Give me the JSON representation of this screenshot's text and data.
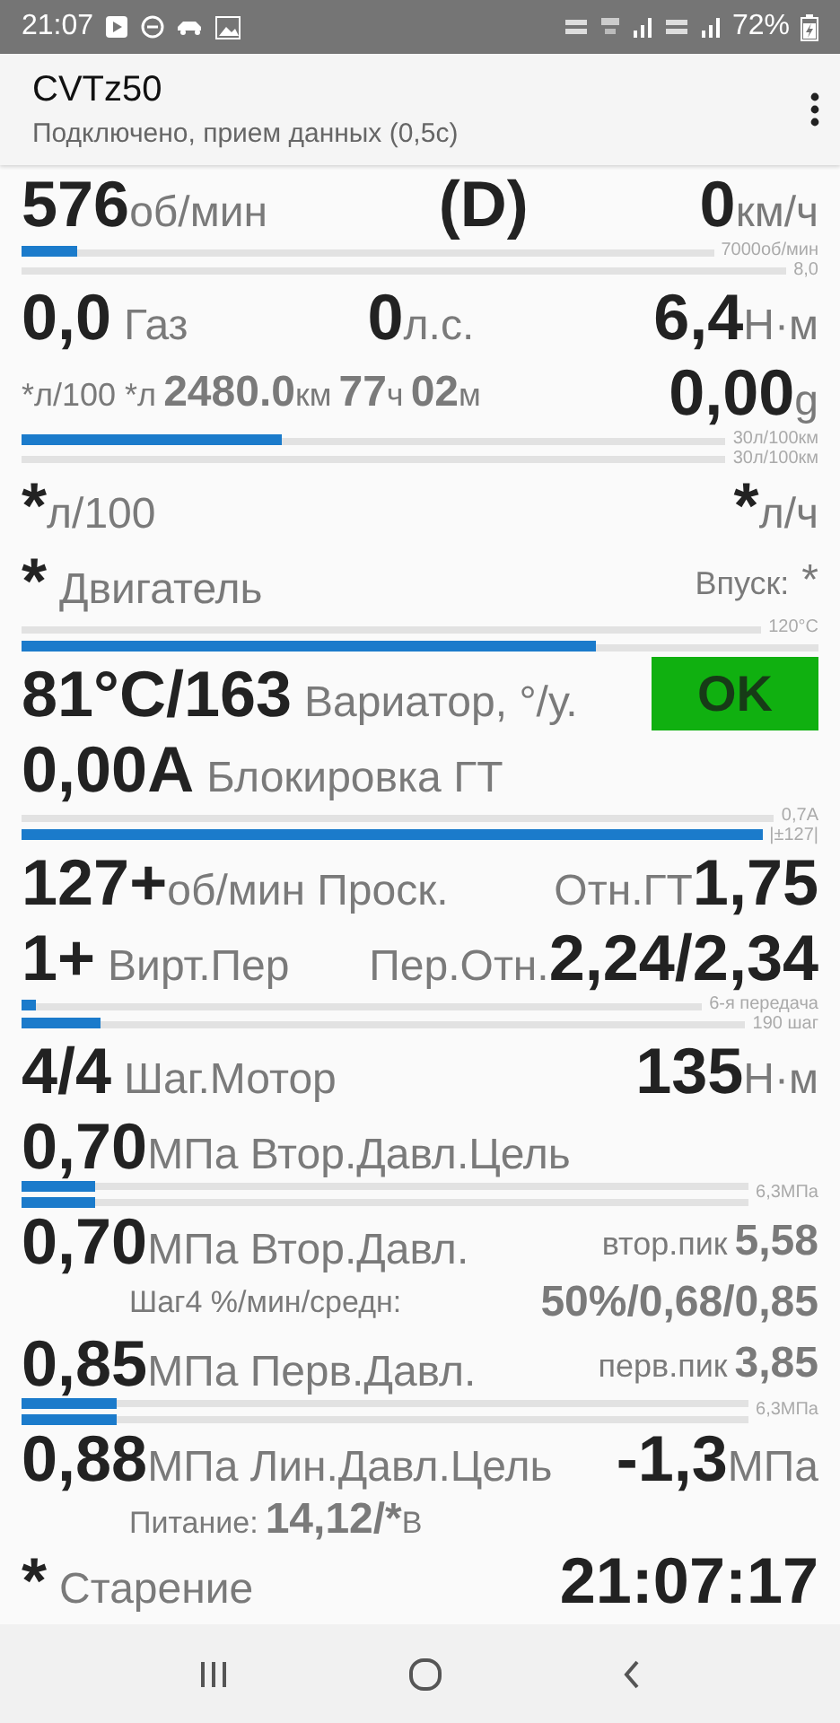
{
  "status_bar": {
    "time": "21:07",
    "battery": "72%"
  },
  "app_bar": {
    "title": "CVTz50",
    "subtitle": "Подключено, прием данных (0,5с)"
  },
  "rows": [
    {
      "kind": "line",
      "segments": [
        [
          {
            "kind": "big",
            "text": "576"
          },
          {
            "kind": "unit",
            "text": "об/мин"
          }
        ],
        [
          {
            "kind": "big",
            "text": "(D)"
          }
        ],
        [
          {
            "kind": "big",
            "text": "0"
          },
          {
            "kind": "unit",
            "text": "км/ч"
          }
        ]
      ]
    },
    {
      "kind": "bar",
      "level": 0.08,
      "caption": "7000об/мин"
    },
    {
      "kind": "bar",
      "level": 0,
      "caption": "8,0"
    },
    {
      "kind": "line",
      "segments": [
        [
          {
            "kind": "big",
            "text": "0,0"
          },
          {
            "kind": "label",
            "text": "Газ"
          }
        ],
        [
          {
            "kind": "big",
            "text": "0"
          },
          {
            "kind": "unit",
            "text": "л.с."
          }
        ],
        [
          {
            "kind": "big",
            "text": "6,4"
          },
          {
            "kind": "unit",
            "text": "Н·м"
          }
        ]
      ]
    },
    {
      "kind": "line",
      "segments": [
        [
          {
            "kind": "small",
            "text": "*л/100 *л"
          },
          {
            "kind": "mid",
            "text": "2480.0"
          },
          {
            "kind": "small",
            "text": "км"
          },
          {
            "kind": "mid",
            "text": "77"
          },
          {
            "kind": "small",
            "text": "ч"
          },
          {
            "kind": "mid",
            "text": "02"
          },
          {
            "kind": "small",
            "text": "м"
          }
        ],
        [
          {
            "kind": "big",
            "text": "0,00"
          },
          {
            "kind": "unit",
            "text": "g"
          }
        ]
      ]
    },
    {
      "kind": "bar",
      "level": 0.37,
      "caption": "30л/100км"
    },
    {
      "kind": "bar",
      "level": 0,
      "caption": "30л/100км"
    },
    {
      "kind": "line",
      "segments": [
        [
          {
            "kind": "big",
            "text": "*"
          },
          {
            "kind": "unit",
            "text": "л/100"
          }
        ],
        [
          {
            "kind": "big",
            "text": "*"
          },
          {
            "kind": "unit",
            "text": "л/ч"
          }
        ]
      ]
    },
    {
      "kind": "line",
      "segments": [
        [
          {
            "kind": "big",
            "text": "*"
          },
          {
            "kind": "label",
            "text": "Двигатель"
          }
        ],
        [
          {
            "kind": "small",
            "text": "Впуск:"
          },
          {
            "kind": "label",
            "text": "*"
          }
        ]
      ]
    },
    {
      "kind": "bar",
      "level": 0,
      "caption": "120°C"
    },
    {
      "kind": "bar",
      "level": 0.72
    },
    {
      "kind": "line",
      "segments": [
        [
          {
            "kind": "big",
            "text": "81°C/163"
          },
          {
            "kind": "label",
            "text": "Вариатор, °/у."
          }
        ],
        [
          {
            "kind": "badge",
            "text": "OK",
            "color": "#10b010"
          }
        ]
      ]
    },
    {
      "kind": "line",
      "segments": [
        [
          {
            "kind": "big",
            "text": "0,00A"
          },
          {
            "kind": "label",
            "text": "Блокировка ГТ"
          }
        ]
      ]
    },
    {
      "kind": "bar",
      "level": 0,
      "caption": "0,7A"
    },
    {
      "kind": "bar",
      "level": 1,
      "caption": "|±127|"
    },
    {
      "kind": "line",
      "segments": [
        [
          {
            "kind": "big",
            "text": "127+"
          },
          {
            "kind": "unit",
            "text": "об/мин Проск."
          }
        ],
        [
          {
            "kind": "label",
            "text": "Отн.ГТ"
          },
          {
            "kind": "big",
            "text": "1,75"
          }
        ]
      ]
    },
    {
      "kind": "line",
      "segments": [
        [
          {
            "kind": "big",
            "text": "1+"
          },
          {
            "kind": "label",
            "text": "Вирт.Пер"
          }
        ],
        [
          {
            "kind": "label",
            "text": "Пер.Отн."
          },
          {
            "kind": "big",
            "text": "2,24/2,34"
          }
        ]
      ]
    },
    {
      "kind": "bar",
      "level": 0.02,
      "caption": "6-я передача"
    },
    {
      "kind": "bar",
      "level": 0.11,
      "caption": "190 шаг"
    },
    {
      "kind": "line",
      "segments": [
        [
          {
            "kind": "big",
            "text": "4/4"
          },
          {
            "kind": "label",
            "text": "Шаг.Мотор"
          }
        ],
        [
          {
            "kind": "big",
            "text": "135"
          },
          {
            "kind": "unit",
            "text": "Н·м"
          }
        ]
      ]
    },
    {
      "kind": "line",
      "segments": [
        [
          {
            "kind": "big",
            "text": "0,70"
          },
          {
            "kind": "unit",
            "text": "МПа Втор.Давл.Цель"
          }
        ]
      ]
    },
    {
      "kind": "double_bar",
      "level": 0.1,
      "caption": "6,3МПа"
    },
    {
      "kind": "line",
      "segments": [
        [
          {
            "kind": "big",
            "text": "0,70"
          },
          {
            "kind": "unit",
            "text": "МПа Втор.Давл."
          }
        ],
        [
          {
            "kind": "small",
            "text": "втор.пик"
          },
          {
            "kind": "mid",
            "text": "5,58"
          }
        ]
      ]
    },
    {
      "kind": "subline",
      "segments": [
        [
          {
            "kind": "small",
            "text": "Шаг4 %/мин/средн:"
          }
        ],
        [
          {
            "kind": "mid",
            "text": "50%/0,68/0,85"
          }
        ]
      ]
    },
    {
      "kind": "line",
      "segments": [
        [
          {
            "kind": "big",
            "text": "0,85"
          },
          {
            "kind": "unit",
            "text": "МПа Перв.Давл."
          }
        ],
        [
          {
            "kind": "small",
            "text": "перв.пик"
          },
          {
            "kind": "mid",
            "text": "3,85"
          }
        ]
      ]
    },
    {
      "kind": "double_bar",
      "level": 0.13,
      "caption": "6,3МПа"
    },
    {
      "kind": "line",
      "segments": [
        [
          {
            "kind": "big",
            "text": "0,88"
          },
          {
            "kind": "unit",
            "text": "МПа Лин.Давл.Цель"
          }
        ],
        [
          {
            "kind": "big",
            "text": "-1,3"
          },
          {
            "kind": "unit",
            "text": "МПа"
          }
        ]
      ]
    },
    {
      "kind": "subline",
      "segments": [
        [
          {
            "kind": "small",
            "text": "Питание:"
          },
          {
            "kind": "mid",
            "text": "14,12/*"
          },
          {
            "kind": "small",
            "text": "В"
          }
        ]
      ]
    },
    {
      "kind": "line",
      "segments": [
        [
          {
            "kind": "big",
            "text": "*"
          },
          {
            "kind": "label",
            "text": "Старение"
          }
        ],
        [
          {
            "kind": "big",
            "text": "21:07:17"
          }
        ]
      ]
    }
  ]
}
